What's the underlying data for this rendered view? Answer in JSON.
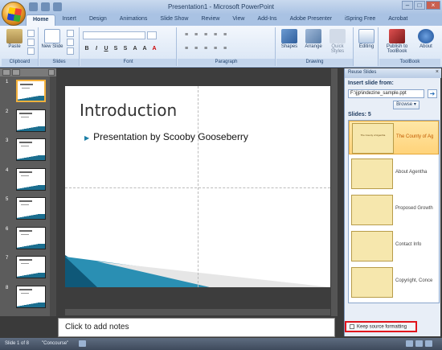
{
  "window": {
    "title": "Presentation1 - Microsoft PowerPoint"
  },
  "ribbon": {
    "tabs": [
      "Home",
      "Insert",
      "Design",
      "Animations",
      "Slide Show",
      "Review",
      "View",
      "Add-Ins",
      "Adobe Presenter",
      "iSpring Free",
      "Acrobat"
    ],
    "paste_label": "Paste",
    "new_slide_label": "New Slide",
    "shapes_label": "Shapes",
    "arrange_label": "Arrange",
    "quick_styles_label": "Quick Styles",
    "editing_label": "Editing",
    "publish_label": "Publish to ToolBook",
    "about_label": "About",
    "groups": [
      "Clipboard",
      "Slides",
      "Font",
      "Paragraph",
      "Drawing",
      "ToolBook"
    ]
  },
  "slide_thumbs": [
    "1",
    "2",
    "3",
    "4",
    "5",
    "6",
    "7",
    "8"
  ],
  "slide": {
    "title": "Introduction",
    "bullet": "Presentation by Scooby Gooseberry"
  },
  "notes_placeholder": "Click to add notes",
  "pane": {
    "heading": "Reuse Slides",
    "insert_from_label": "Insert slide from:",
    "path": "F:\\jjp\\indezine_sample.ppt",
    "browse_label": "Browse",
    "slides_label": "Slides: 5",
    "slides": [
      {
        "name": "The County of Ag",
        "thumb_title": "The County of Agentha"
      },
      {
        "name": "About Agentha"
      },
      {
        "name": "Proposed Growth"
      },
      {
        "name": "Contact Info"
      },
      {
        "name": "Copyright, Conce"
      }
    ],
    "keep_source_label": "Keep source formatting"
  },
  "statusbar": {
    "slide_info": "Slide 1 of 8",
    "theme": "\"Concourse\""
  },
  "colors": {
    "accent": "#1b7ea6",
    "highlight": "#ffd37a",
    "red_callout": "#e0141c"
  }
}
